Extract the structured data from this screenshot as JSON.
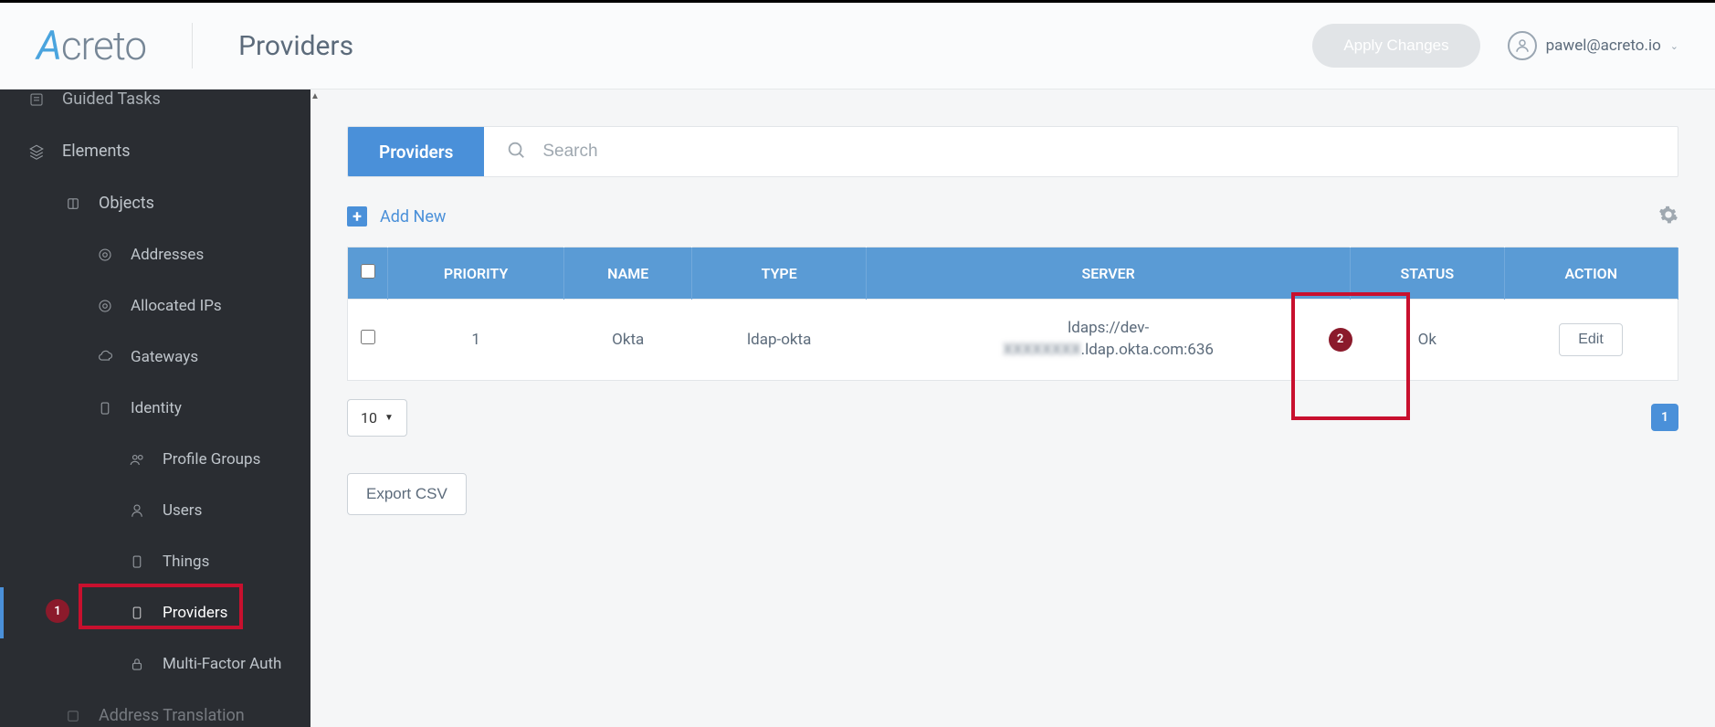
{
  "header": {
    "logo_text": "creto",
    "logo_accent": "A",
    "page_title": "Providers",
    "apply_label": "Apply Changes",
    "user_email": "pawel@acreto.io"
  },
  "sidebar": {
    "items": [
      {
        "label": "Guided Tasks"
      },
      {
        "label": "Elements"
      },
      {
        "label": "Objects"
      },
      {
        "label": "Addresses"
      },
      {
        "label": "Allocated IPs"
      },
      {
        "label": "Gateways"
      },
      {
        "label": "Identity"
      },
      {
        "label": "Profile Groups"
      },
      {
        "label": "Users"
      },
      {
        "label": "Things"
      },
      {
        "label": "Providers"
      },
      {
        "label": "Multi-Factor Auth"
      },
      {
        "label": "Address Translation"
      }
    ]
  },
  "main": {
    "tab_label": "Providers",
    "search_placeholder": "Search",
    "add_new_label": "Add New",
    "table": {
      "headers": [
        "PRIORITY",
        "NAME",
        "TYPE",
        "SERVER",
        "STATUS",
        "ACTION"
      ],
      "rows": [
        {
          "priority": "1",
          "name": "Okta",
          "type": "ldap-okta",
          "server_pre": "ldaps://dev-",
          "server_blur": "XXXXXXXX",
          "server_post": ".ldap.okta.com:636",
          "status": "Ok",
          "action": "Edit"
        }
      ]
    },
    "page_size": "10",
    "page_num": "1",
    "export_label": "Export CSV"
  },
  "annotations": {
    "callout1": "1",
    "callout2": "2"
  }
}
